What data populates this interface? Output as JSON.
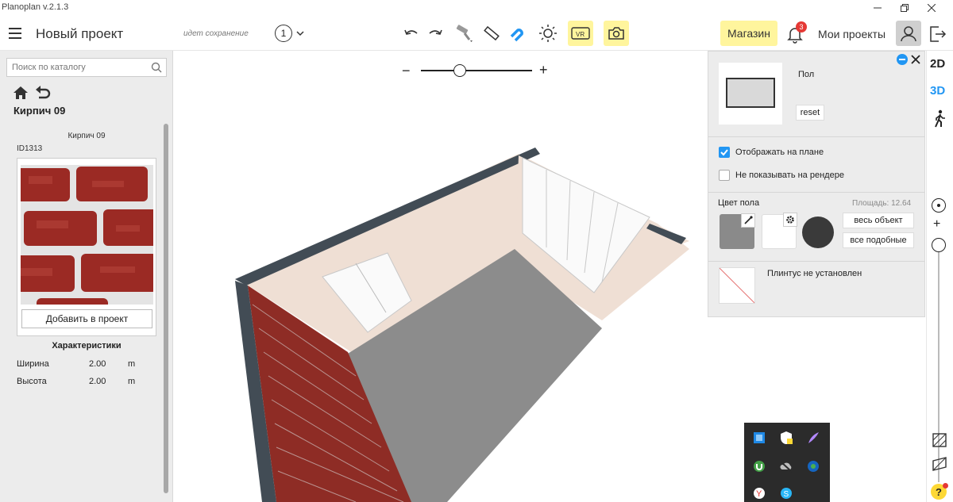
{
  "app": {
    "title": "Planoplan v.2.1.3"
  },
  "header": {
    "project_title": "Новый проект",
    "saving_status": "идет сохранение",
    "floor_number": "1",
    "shop_label": "Магазин",
    "notifications_count": "3",
    "my_projects_label": "Мои проекты"
  },
  "sidebar": {
    "search_placeholder": "Поиск по каталогу",
    "item_title": "Кирпич 09",
    "card_name": "Кирпич 09",
    "item_id": "ID1313",
    "add_button": "Добавить в проект",
    "characteristics_title": "Характеристики",
    "characteristics": [
      {
        "label": "Ширина",
        "value": "2.00",
        "unit": "m"
      },
      {
        "label": "Высота",
        "value": "2.00",
        "unit": "m"
      }
    ]
  },
  "properties": {
    "object_label": "Пол",
    "reset_label": "reset",
    "show_on_plan": "Отображать на плане",
    "show_on_plan_checked": true,
    "hide_on_render": "Не показывать на рендере",
    "hide_on_render_checked": false,
    "color_title": "Цвет пола",
    "area_label": "Площадь: 12.64",
    "apply_whole_object": "весь объект",
    "apply_similar": "все подобные",
    "plinth_label": "Плинтус не установлен"
  },
  "right_toolbar": {
    "mode_2d": "2D",
    "mode_3d": "3D",
    "active_mode": "3D",
    "help": "?"
  },
  "colors": {
    "accent": "#2196f3",
    "highlight": "#fff59d",
    "badge": "#e53935",
    "floor_color": "#8a8a8a",
    "wall_color": "#efdfd4"
  }
}
